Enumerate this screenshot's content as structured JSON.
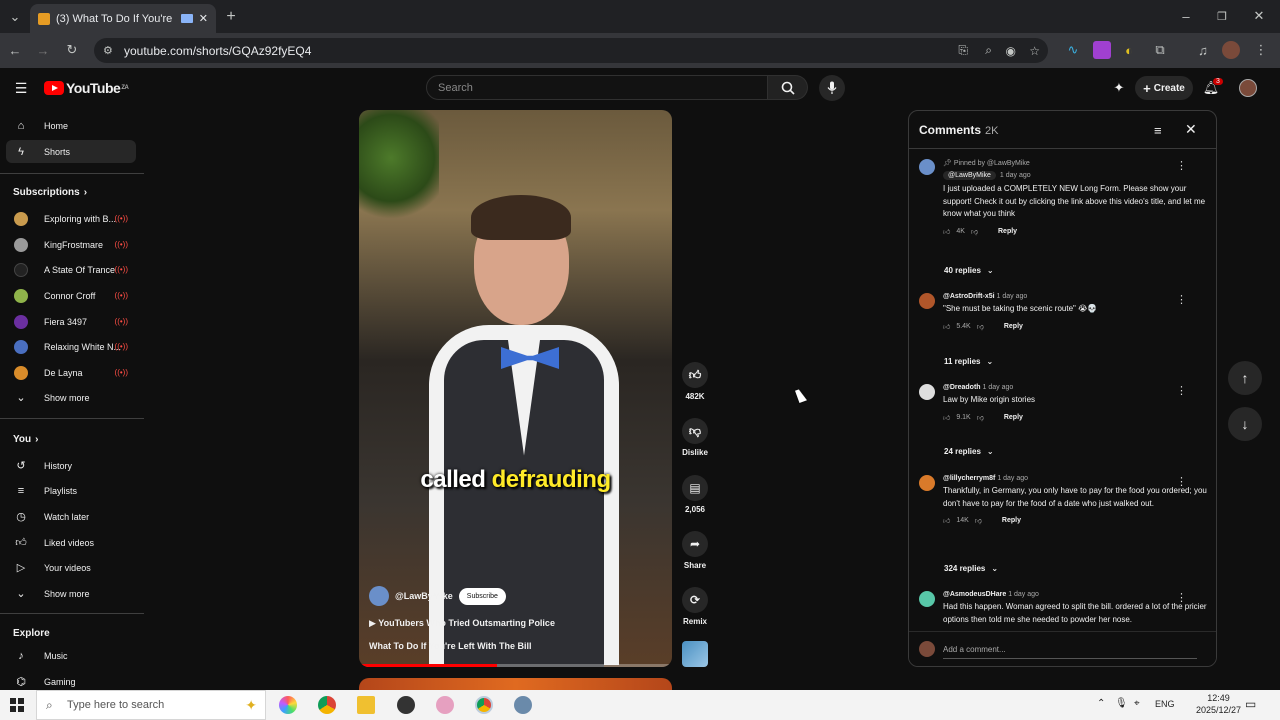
{
  "browser": {
    "tab_title": "(3) What To Do If You're Lef",
    "url": "youtube.com/shorts/GQAz92fyEQ4"
  },
  "header": {
    "logo_text": "YouTube",
    "logo_sup": "ZA",
    "search_placeholder": "Search",
    "create_label": "Create",
    "notif_count": "3"
  },
  "sidebar": {
    "main": [
      {
        "label": "Home",
        "icon": "home-icon"
      },
      {
        "label": "Shorts",
        "icon": "shorts-icon"
      }
    ],
    "subscriptions_heading": "Subscriptions",
    "subscriptions": [
      {
        "label": "Exploring with B...",
        "color": "#c99b4e"
      },
      {
        "label": "KingFrostmare",
        "color": "#9a9a9a"
      },
      {
        "label": "A State Of Trance",
        "color": "#222222"
      },
      {
        "label": "Connor Croff",
        "color": "#8fb34a"
      },
      {
        "label": "Fiera 3497",
        "color": "#6b2fa0"
      },
      {
        "label": "Relaxing White N...",
        "color": "#4a6fc0"
      },
      {
        "label": "De Layna",
        "color": "#d98c2a"
      }
    ],
    "subs_show_more": "Show more",
    "you_heading": "You",
    "you_items": [
      {
        "label": "History"
      },
      {
        "label": "Playlists"
      },
      {
        "label": "Watch later"
      },
      {
        "label": "Liked videos"
      },
      {
        "label": "Your videos"
      }
    ],
    "you_show_more": "Show more",
    "explore_heading": "Explore",
    "explore_items": [
      {
        "label": "Music"
      },
      {
        "label": "Gaming"
      }
    ]
  },
  "video": {
    "caption_a": "called ",
    "caption_b": "defrauding",
    "channel": "@LawByMike",
    "subscribe": "Subscribe",
    "playlist": "YouTubers Who Tried Outsmarting Police",
    "title": "What To Do If You're Left With The Bill",
    "progress": 0.44
  },
  "actions": {
    "likes": "482K",
    "dislike": "Dislike",
    "comments": "2,056",
    "share": "Share",
    "remix": "Remix"
  },
  "comments": {
    "title": "Comments",
    "count": "2K",
    "items": [
      {
        "pinned": "Pinned by @LawByMike",
        "author": "@LawByMike",
        "time": "1 day ago",
        "text": "I just uploaded a COMPLETELY NEW Long Form. Please show your support! Check it out by clicking the link above this video's title, and let me know what you think",
        "likes": "4K",
        "reply": "Reply",
        "replies": "40 replies",
        "color": "#6a8fc9"
      },
      {
        "author": "@AstroDrift-x5i",
        "time": "1 day ago",
        "text": "\"She must be taking the scenic route\" 😭💀",
        "likes": "5.4K",
        "reply": "Reply",
        "replies": "11 replies",
        "color": "#b0562a"
      },
      {
        "author": "@Dreadoth",
        "time": "1 day ago",
        "text": "Law by Mike origin stories",
        "likes": "9.1K",
        "reply": "Reply",
        "replies": "24 replies",
        "color": "#dddddd"
      },
      {
        "author": "@lillycherrym8f",
        "time": "1 day ago",
        "text": "Thankfully, in Germany, you only have to pay for the food you ordered; you don't have to pay for the food of a date who just walked out.",
        "likes": "14K",
        "reply": "Reply",
        "replies": "324 replies",
        "color": "#d97a2a"
      },
      {
        "author": "@AsmodeusDHare",
        "time": "1 day ago",
        "text": "Had this happen.  Woman agreed to split the bill. ordered a lot of the pricier options then told me she needed to powder her nose.",
        "color": "#58c7a8"
      }
    ],
    "add_placeholder": "Add a comment..."
  },
  "taskbar": {
    "search_placeholder": "Type here to search",
    "lang": "ENG",
    "time": "12:49",
    "date": "2025/12/27"
  }
}
